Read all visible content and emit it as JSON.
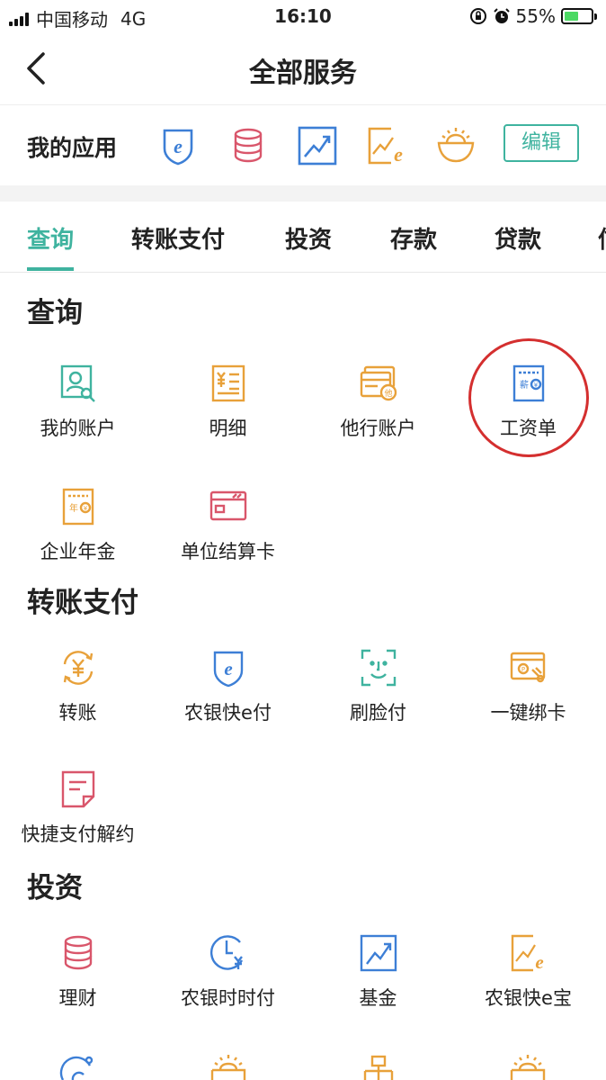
{
  "status_bar": {
    "carrier": "中国移动",
    "network": "4G",
    "time": "16:10",
    "battery_percent": "55%",
    "battery_level": 0.55
  },
  "nav": {
    "title": "全部服务",
    "back_icon": "chevron-left-icon"
  },
  "my_apps": {
    "label": "我的应用",
    "edit_label": "编辑",
    "icons": [
      "e-pay-shield-icon",
      "coin-stack-icon",
      "trend-chart-icon",
      "trend-e-icon",
      "gold-bowl-icon"
    ]
  },
  "tabs": [
    "查询",
    "转账支付",
    "投资",
    "存款",
    "贷款",
    "信"
  ],
  "sections": {
    "query": {
      "title": "查询",
      "items": [
        {
          "label": "我的账户",
          "icon": "account-search-icon"
        },
        {
          "label": "明细",
          "icon": "yuan-statement-icon"
        },
        {
          "label": "他行账户",
          "icon": "other-bank-card-icon"
        },
        {
          "label": "工资单",
          "icon": "salary-slip-icon"
        },
        {
          "label": "企业年金",
          "icon": "annuity-doc-icon"
        },
        {
          "label": "单位结算卡",
          "icon": "settlement-card-icon"
        }
      ]
    },
    "transfer": {
      "title": "转账支付",
      "items": [
        {
          "label": "转账",
          "icon": "transfer-yuan-icon"
        },
        {
          "label": "农银快e付",
          "icon": "e-pay-shield-icon"
        },
        {
          "label": "刷脸付",
          "icon": "face-scan-icon"
        },
        {
          "label": "一键绑卡",
          "icon": "bind-card-icon"
        },
        {
          "label": "快捷支付解约",
          "icon": "note-cancel-icon"
        }
      ]
    },
    "invest": {
      "title": "投资",
      "items": [
        {
          "label": "理财",
          "icon": "coin-stack-icon"
        },
        {
          "label": "农银时时付",
          "icon": "clock-yuan-icon"
        },
        {
          "label": "基金",
          "icon": "trend-chart-icon"
        },
        {
          "label": "农银快e宝",
          "icon": "trend-e-icon"
        }
      ]
    }
  },
  "colors": {
    "accent": "#3fb39f",
    "blue": "#3d7fd6",
    "orange": "#e8a13a",
    "pink": "#d9566b",
    "circle": "#d42f2f"
  }
}
